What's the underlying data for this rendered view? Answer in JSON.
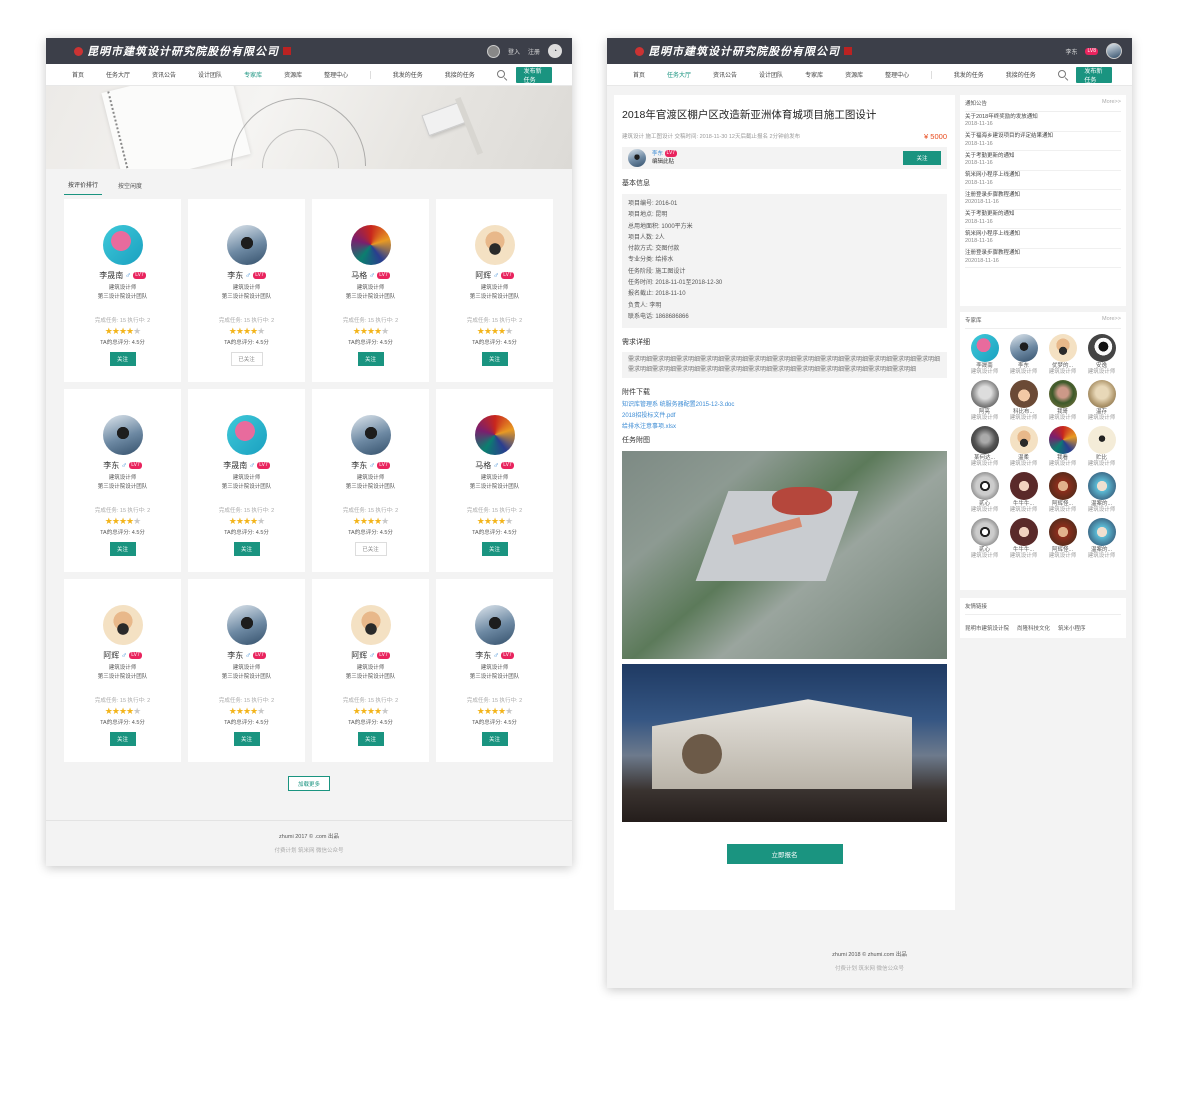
{
  "left": {
    "logo": "昆明市建筑设计研究院股份有限公司",
    "header": {
      "login": "登入",
      "register": "注册"
    },
    "nav": [
      "首页",
      "任务大厅",
      "资讯公告",
      "设计团队",
      "专家库",
      "资源库",
      "整理中心",
      "我发的任务",
      "我接的任务"
    ],
    "nav_active": 4,
    "publish": "发布新任务",
    "tabs": [
      "按评价排行",
      "按空闲度"
    ],
    "cards": [
      {
        "name": "李晟南",
        "lv": "LV7",
        "role": "建筑设计师",
        "team": "第三设计院设计团队",
        "stats": "完成任务: 15  执行中: 2",
        "rating": 4,
        "score": "TA的总评分: 4.5分",
        "btn": "关注",
        "followed": false,
        "av": "a"
      },
      {
        "name": "李东",
        "lv": "LV7",
        "role": "建筑设计师",
        "team": "第三设计院设计团队",
        "stats": "完成任务: 15  执行中: 2",
        "rating": 4,
        "score": "TA的总评分: 4.5分",
        "btn": "已关注",
        "followed": true,
        "av": "b"
      },
      {
        "name": "马格",
        "lv": "LV7",
        "role": "建筑设计师",
        "team": "第三设计院设计团队",
        "stats": "完成任务: 15  执行中: 2",
        "rating": 4,
        "score": "TA的总评分: 4.5分",
        "btn": "关注",
        "followed": false,
        "av": "c"
      },
      {
        "name": "阿辉",
        "lv": "LV7",
        "role": "建筑设计师",
        "team": "第三设计院设计团队",
        "stats": "完成任务: 15  执行中: 2",
        "rating": 4,
        "score": "TA的总评分: 4.5分",
        "btn": "关注",
        "followed": false,
        "av": "d"
      },
      {
        "name": "李东",
        "lv": "LV7",
        "role": "建筑设计师",
        "team": "第三设计院设计团队",
        "stats": "完成任务: 15  执行中: 2",
        "rating": 4,
        "score": "TA的总评分: 4.5分",
        "btn": "关注",
        "followed": false,
        "av": "b"
      },
      {
        "name": "李晟南",
        "lv": "LV7",
        "role": "建筑设计师",
        "team": "第三设计院设计团队",
        "stats": "完成任务: 15  执行中: 2",
        "rating": 4,
        "score": "TA的总评分: 4.5分",
        "btn": "关注",
        "followed": false,
        "av": "a"
      },
      {
        "name": "李东",
        "lv": "LV7",
        "role": "建筑设计师",
        "team": "第三设计院设计团队",
        "stats": "完成任务: 15  执行中: 2",
        "rating": 4,
        "score": "TA的总评分: 4.5分",
        "btn": "已关注",
        "followed": true,
        "av": "b"
      },
      {
        "name": "马格",
        "lv": "LV7",
        "role": "建筑设计师",
        "team": "第三设计院设计团队",
        "stats": "完成任务: 15  执行中: 2",
        "rating": 4,
        "score": "TA的总评分: 4.5分",
        "btn": "关注",
        "followed": false,
        "av": "c"
      },
      {
        "name": "阿辉",
        "lv": "LV7",
        "role": "建筑设计师",
        "team": "第三设计院设计团队",
        "stats": "完成任务: 15  执行中: 2",
        "rating": 4,
        "score": "TA的总评分: 4.5分",
        "btn": "关注",
        "followed": false,
        "av": "d"
      },
      {
        "name": "李东",
        "lv": "LV7",
        "role": "建筑设计师",
        "team": "第三设计院设计团队",
        "stats": "完成任务: 15  执行中: 2",
        "rating": 4,
        "score": "TA的总评分: 4.5分",
        "btn": "关注",
        "followed": false,
        "av": "b"
      },
      {
        "name": "阿辉",
        "lv": "LV7",
        "role": "建筑设计师",
        "team": "第三设计院设计团队",
        "stats": "完成任务: 15  执行中: 2",
        "rating": 4,
        "score": "TA的总评分: 4.5分",
        "btn": "关注",
        "followed": false,
        "av": "d"
      },
      {
        "name": "李东",
        "lv": "LV7",
        "role": "建筑设计师",
        "team": "第三设计院设计团队",
        "stats": "完成任务: 15  执行中: 2",
        "rating": 4,
        "score": "TA的总评分: 4.5分",
        "btn": "关注",
        "followed": false,
        "av": "b"
      }
    ],
    "load_more": "加载更多",
    "footer": {
      "line1": "zhumi   2017 ©   .com 出品",
      "line2": "付费计划    筑米网    微信公众号"
    }
  },
  "right": {
    "logo": "昆明市建筑设计研究院股份有限公司",
    "user": "李东",
    "user_lv": "LV8",
    "nav": [
      "首页",
      "任务大厅",
      "资讯公告",
      "设计团队",
      "专家库",
      "资源库",
      "整理中心",
      "我发的任务",
      "我接的任务"
    ],
    "nav_active": 1,
    "publish": "发布新任务",
    "task": {
      "title": "2018年官渡区棚户区改造新亚洲体育城项目施工图设计",
      "meta": "建筑设计 施工图设计  交稿时间: 2018-11-30  12天后截止报名  2分钟前发布",
      "price": "¥ 5000",
      "publisher": "李东",
      "publisher_lv": "LV7",
      "publisher_sub": "编辑此贴",
      "follow": "关注",
      "basic_title": "基本信息",
      "basic": [
        "项目编号: 2016-01",
        "项目地点: 昆明",
        "总用地面积: 1000平方米",
        "项目人数: 2人",
        "付款方式: 交图付款",
        "专业分类: 给排水",
        "任务阶段: 施工图设计",
        "任务时间: 2018-11-01至2018-12-30",
        "报名截止: 2018-11-10",
        "负责人: 李明",
        "联系电话: 1868686866"
      ],
      "req_title": "需求详细",
      "req": "需求明细需求明细需求明细需求明细需求明细需求明细需求明细需求明细需求明细需求明细需求明细需求明细需求明细需求明细需求明细需求明细需求明细需求明细需求明细需求明细需求明细需求明细需求明细需求明细需求明细",
      "att_title": "附件下载",
      "attachments": [
        "知识库管理系 统服务器配置2015-12-3.doc",
        "2018招投标文件.pdf",
        "给排水注意事项.xlsx"
      ],
      "img_title": "任务附图",
      "apply": "立即报名"
    },
    "notice": {
      "title": "通知公告",
      "more": "More>>",
      "items": [
        {
          "t": "关于2018年终奖励的发放通知",
          "d": "2018-11-16"
        },
        {
          "t": "关于福海乡建设项目的评定结果通知",
          "d": "2018-11-16"
        },
        {
          "t": "关于考勤更新的通知",
          "d": "2018-11-16"
        },
        {
          "t": "筑米网小程序上线通知",
          "d": "2018-11-16"
        },
        {
          "t": "注册登录步骤教程通知",
          "d": "202018-11-16"
        },
        {
          "t": "关于考勤更新的通知",
          "d": "2018-11-16"
        },
        {
          "t": "筑米网小程序上线通知",
          "d": "2018-11-16"
        },
        {
          "t": "注册登录步骤教程通知",
          "d": "202018-11-16"
        }
      ]
    },
    "experts": {
      "title": "专家库",
      "more": "More>>",
      "items": [
        {
          "n": "李晟南",
          "r": "建筑设计师",
          "c": "av-a"
        },
        {
          "n": "李东",
          "r": "建筑设计师",
          "c": "av-b"
        },
        {
          "n": "优梦的...",
          "r": "建筑设计师",
          "c": "av-d"
        },
        {
          "n": "安逸",
          "r": "建筑设计师",
          "c": "av-g"
        },
        {
          "n": "阿亮",
          "r": "建筑设计师",
          "c": "av-h"
        },
        {
          "n": "科比布...",
          "r": "建筑设计师",
          "c": "av-i"
        },
        {
          "n": "我哥",
          "r": "建筑设计师",
          "c": "av-j"
        },
        {
          "n": "温存",
          "r": "建筑设计师",
          "c": "av-k"
        },
        {
          "n": "某何达...",
          "r": "建筑设计师",
          "c": "av-l"
        },
        {
          "n": "温柔",
          "r": "建筑设计师",
          "c": "av-d"
        },
        {
          "n": "我看",
          "r": "建筑设计师",
          "c": "av-c"
        },
        {
          "n": "贮比",
          "r": "建筑设计师",
          "c": "av-m"
        },
        {
          "n": "贰心",
          "r": "建筑设计师",
          "c": "av-n"
        },
        {
          "n": "牛牛牛...",
          "r": "建筑设计师",
          "c": "av-o"
        },
        {
          "n": "阿辉怪...",
          "r": "建筑设计师",
          "c": "av-p"
        },
        {
          "n": "温案的...",
          "r": "建筑设计师",
          "c": "av-q"
        },
        {
          "n": "贰心",
          "r": "建筑设计师",
          "c": "av-n"
        },
        {
          "n": "牛牛牛...",
          "r": "建筑设计师",
          "c": "av-o"
        },
        {
          "n": "阿辉怪...",
          "r": "建筑设计师",
          "c": "av-p"
        },
        {
          "n": "温案的...",
          "r": "建筑设计师",
          "c": "av-q"
        }
      ]
    },
    "links": {
      "title": "友情链接",
      "items": [
        "昆明市建筑设计院",
        "尚隆科技文化",
        "筑米小程序"
      ]
    },
    "footer": {
      "line1": "zhumi   2018 ©   zhumi.com 出品",
      "line2": "付费计划    筑米网    微信公众号"
    }
  }
}
